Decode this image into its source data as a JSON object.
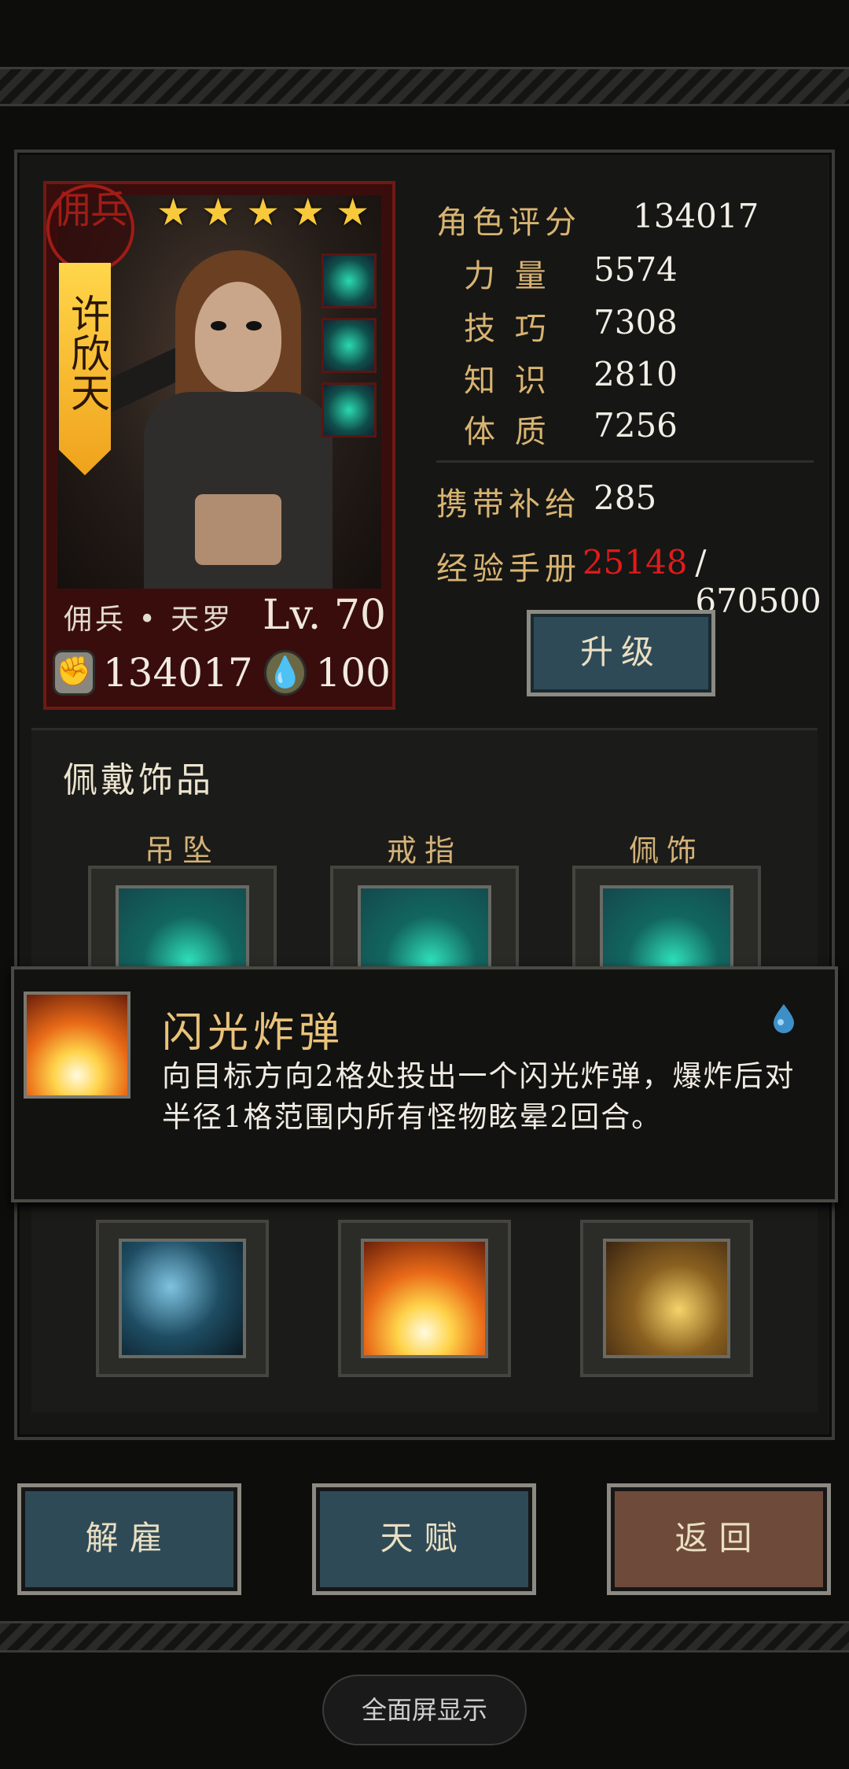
{
  "character": {
    "seal_text": "佣兵",
    "name": "许欣天",
    "stars": [
      "★",
      "★",
      "★",
      "★",
      "★"
    ],
    "class_name": "佣兵 • 天罗",
    "level": "Lv. 70",
    "power": "134017",
    "stamina": "100"
  },
  "stats": {
    "score_label": "角色评分",
    "score_value": "134017",
    "strength_label": "力 量",
    "strength_value": "5574",
    "skill_label": "技 巧",
    "skill_value": "7308",
    "knowledge_label": "知 识",
    "knowledge_value": "2810",
    "physique_label": "体 质",
    "physique_value": "7256",
    "supply_label": "携带补给",
    "supply_value": "285",
    "exp_label": "经验手册",
    "exp_current": "25148",
    "exp_total": "/ 670500",
    "upgrade_label": "升级"
  },
  "accessories": {
    "title": "佩戴饰品",
    "slots": [
      {
        "label": "吊坠",
        "icon": "pendant-icon"
      },
      {
        "label": "戒指",
        "icon": "ring-icon"
      },
      {
        "label": "佩饰",
        "icon": "charm-icon"
      }
    ]
  },
  "tooltip": {
    "icon": "flash-bomb-icon",
    "title": "闪光炸弹",
    "desc": "向目标方向2格处投出一个闪光炸弹，爆炸后对半径1格范围内所有怪物眩晕2回合。",
    "badge_icon": "water-drop-icon"
  },
  "skills": [
    "ice-cave-skill-icon",
    "flash-bomb-skill-icon",
    "dagger-skill-icon"
  ],
  "buttons": {
    "dismiss": "解雇",
    "talent": "天赋",
    "back": "返回"
  },
  "system": {
    "fullscreen": "全面屏显示"
  },
  "colors": {
    "accent_gold": "#d8b472",
    "exp_red": "#e01b1b",
    "card_red": "#3a0d0d",
    "button_blue": "#2f4a57",
    "button_brown": "#6e4a3a"
  }
}
